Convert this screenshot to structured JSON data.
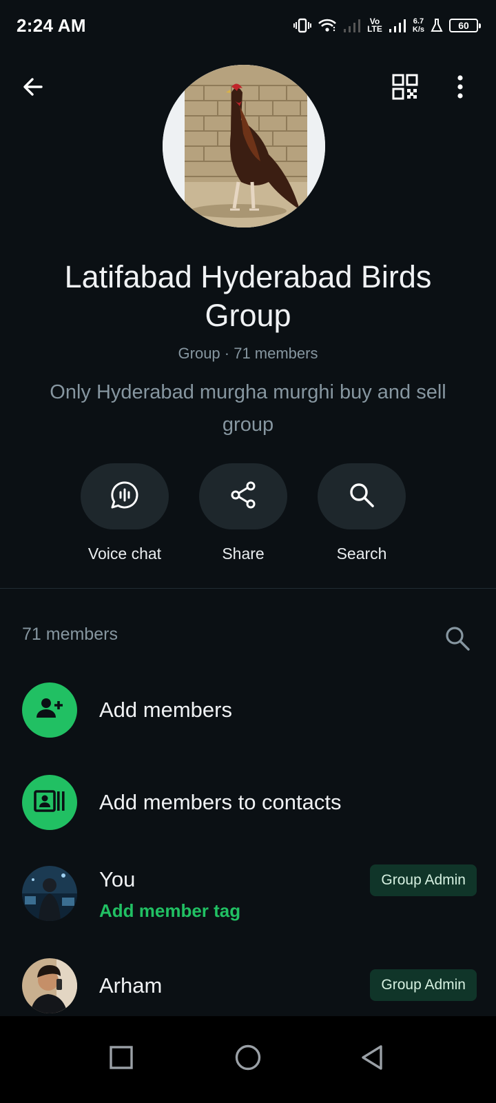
{
  "status_bar": {
    "time": "2:24 AM",
    "volte_line1": "Vo",
    "volte_line2": "LTE",
    "speed_value": "6.7",
    "speed_unit": "K/s",
    "battery": "60",
    "icons": [
      "vibrate-icon",
      "wifi-icon",
      "signal-icon",
      "signal-icon",
      "lab-icon",
      "battery-icon"
    ]
  },
  "header": {
    "back_icon": "arrow-left-icon",
    "qr_icon": "qr-code-icon",
    "more_icon": "more-vertical-icon"
  },
  "group": {
    "name": "Latifabad Hyderabad Birds Group",
    "meta": "Group · 71 members",
    "description": "Only Hyderabad murgha murghi buy and sell group"
  },
  "actions": [
    {
      "label": "Voice chat",
      "icon": "voice-chat-icon"
    },
    {
      "label": "Share",
      "icon": "share-icon"
    },
    {
      "label": "Search",
      "icon": "search-icon"
    }
  ],
  "members": {
    "count_label": "71 members",
    "add_members_label": "Add members",
    "add_to_contacts_label": "Add members to contacts",
    "list": [
      {
        "name": "You",
        "subtitle": "Add member tag",
        "badge": "Group Admin"
      },
      {
        "name": "Arham",
        "badge": "Group Admin"
      }
    ]
  },
  "colors": {
    "background": "#0b1014",
    "accent": "#21c063",
    "pill": "#1e272c",
    "badge_bg": "#103529",
    "muted_text": "#8696a0"
  },
  "nav_bar": {
    "icons": [
      "recents-square-icon",
      "home-circle-icon",
      "back-triangle-icon"
    ]
  }
}
